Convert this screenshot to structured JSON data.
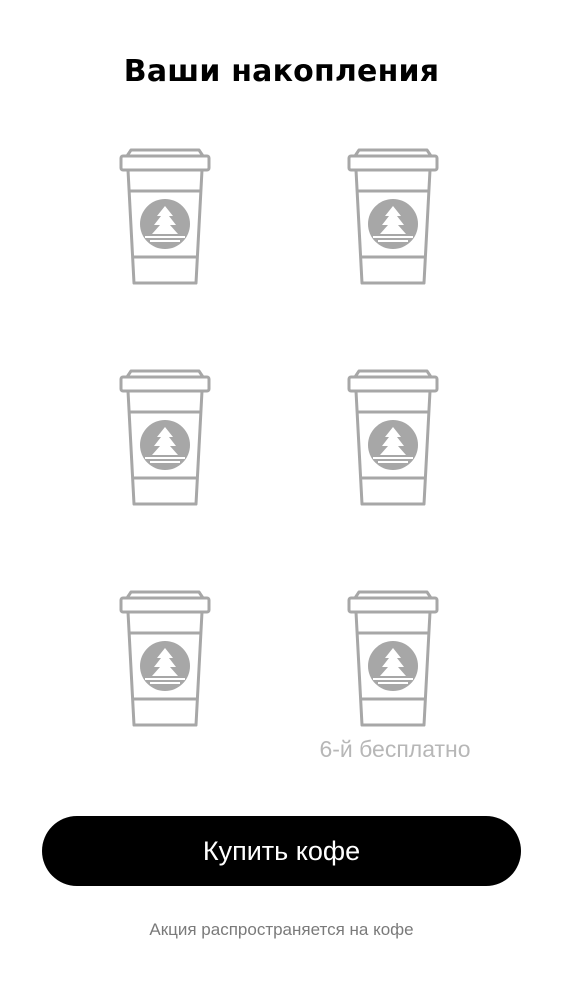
{
  "header": {
    "title": "Ваши накопления"
  },
  "stamps": {
    "total": 6,
    "collected": 0,
    "cup_icon": "coffee-cup-icon",
    "logo_icon": "fir-tree-logo-icon",
    "cup_color": "#a7a7a7"
  },
  "free_label": "6-й бесплатно",
  "buy_button": {
    "label": "Купить кофе"
  },
  "footnote": "Акция распространяется на кофе",
  "colors": {
    "background": "#ffffff",
    "button_bg": "#000000",
    "button_text": "#ffffff",
    "muted_text": "#b7b7b7"
  }
}
